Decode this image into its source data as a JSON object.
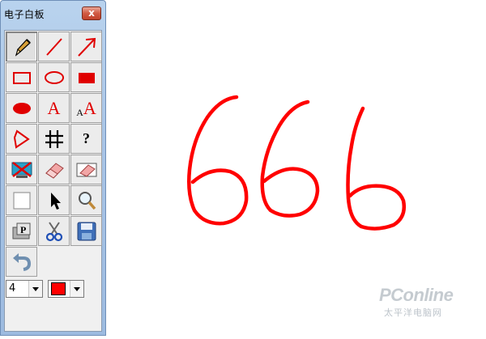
{
  "window": {
    "title": "电子白板",
    "close_label": "x"
  },
  "tools": [
    {
      "name": "pencil",
      "pressed": true
    },
    {
      "name": "line"
    },
    {
      "name": "arrow"
    },
    {
      "name": "rectangle-outline"
    },
    {
      "name": "ellipse-outline"
    },
    {
      "name": "rectangle-filled"
    },
    {
      "name": "ellipse-filled"
    },
    {
      "name": "text",
      "label": "A"
    },
    {
      "name": "text-size",
      "label_small": "A",
      "label_large": "A"
    },
    {
      "name": "polygon"
    },
    {
      "name": "grid"
    },
    {
      "name": "help",
      "label": "?"
    },
    {
      "name": "clear-screen"
    },
    {
      "name": "eraser"
    },
    {
      "name": "area-eraser"
    },
    {
      "name": "blank"
    },
    {
      "name": "select-pointer"
    },
    {
      "name": "zoom"
    },
    {
      "name": "stamp",
      "label": "P"
    },
    {
      "name": "cut"
    },
    {
      "name": "save"
    },
    {
      "name": "undo"
    }
  ],
  "line_width": {
    "value": "4"
  },
  "color": {
    "value": "#ff0000"
  },
  "canvas": {
    "text": "666",
    "stroke_color": "#ff0000"
  },
  "watermark": {
    "logo": "PConline",
    "sub": "太平洋电脑网"
  }
}
